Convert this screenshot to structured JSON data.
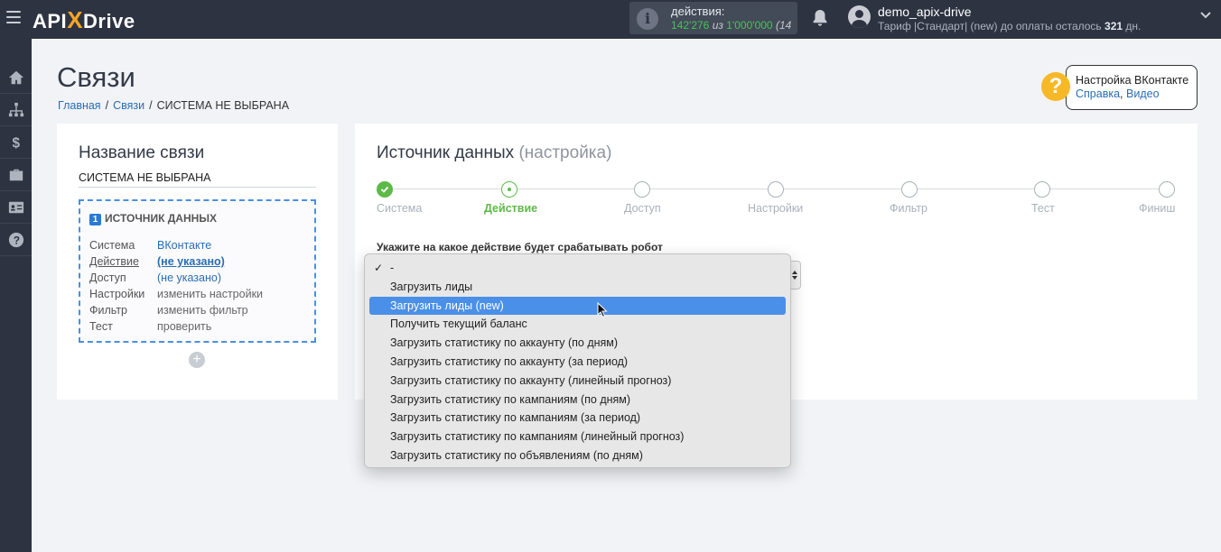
{
  "brand": {
    "part1": "API",
    "x": "X",
    "part2": "Drive"
  },
  "header": {
    "actions_label": "действия:",
    "actions_used": "142'276",
    "actions_of": "из",
    "actions_limit": "1'000'000",
    "actions_pct": "(14",
    "user_name": "demo_apix-drive",
    "plan_text": "Тариф |Стандарт| (new) до оплаты осталось",
    "plan_days": "321",
    "plan_days_unit": "дн."
  },
  "sidebar": {
    "icons": [
      "home-icon",
      "sitemap-icon",
      "dollar-icon",
      "briefcase-icon",
      "id-card-icon",
      "help-circle-icon"
    ]
  },
  "page": {
    "title": "Связи",
    "breadcrumb": [
      "Главная",
      "Связи",
      "СИСТЕМА НЕ ВЫБРАНА"
    ]
  },
  "help": {
    "title": "Настройка ВКонтакте",
    "link1": "Справка",
    "comma": ",",
    "link2": "Видео"
  },
  "left_card": {
    "heading": "Название связи",
    "connection_name": "СИСТЕМА НЕ ВЫБРАНА",
    "source_num": "1",
    "source_title": "ИСТОЧНИК ДАННЫХ",
    "rows": [
      {
        "key": "Система",
        "value": "ВКонтакте"
      },
      {
        "key": "Действие",
        "value": "(не указано)"
      },
      {
        "key": "Доступ",
        "value": "(не указано)"
      },
      {
        "key": "Настройки",
        "value": "изменить настройки"
      },
      {
        "key": "Фильтр",
        "value": "изменить фильтр"
      },
      {
        "key": "Тест",
        "value": "проверить"
      }
    ],
    "add_symbol": "+"
  },
  "right_card": {
    "heading": "Источник данных",
    "heading_sub": "(настройка)",
    "steps": [
      "Система",
      "Действие",
      "Доступ",
      "Настройки",
      "Фильтр",
      "Тест",
      "Финиш"
    ],
    "current_step": 1,
    "action_prompt": "Укажите на какое действие будет срабатывать робот"
  },
  "dropdown": {
    "check_mark": "✓",
    "selected_index": 2,
    "options": [
      "-",
      "Загрузить лиды",
      "Загрузить лиды (new)",
      "Получить текущий баланс",
      "Загрузить статистику по аккаунту (по дням)",
      "Загрузить статистику по аккаунту (за период)",
      "Загрузить статистику по аккаунту (линейный прогноз)",
      "Загрузить статистику по кампаниям (по дням)",
      "Загрузить статистику по кампаниям (за период)",
      "Загрузить статистику по кампаниям (линейный прогноз)",
      "Загрузить статистику по объявлениям (по дням)"
    ]
  }
}
